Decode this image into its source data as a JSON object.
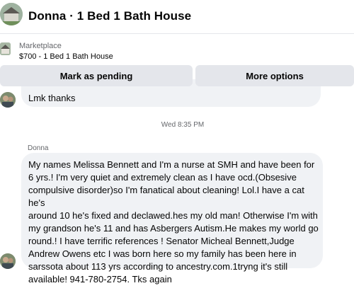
{
  "header": {
    "title": "Donna · 1 Bed 1 Bath House"
  },
  "listing": {
    "source": "Marketplace",
    "title": "$700 - 1 Bed 1 Bath House"
  },
  "actions": {
    "mark_pending": "Mark as pending",
    "more_options": "More options"
  },
  "conversation": {
    "previous_message": "Lmk thanks",
    "timestamp": "Wed 8:35 PM",
    "sender": "Donna",
    "message": "My names Melissa Bennett and I'm a nurse  at SMH  and have been for\n6 yrs.! I'm very quiet and extremely clean as I have ocd.(Obsesive\ncompulsive disorder)so I'm fanatical about cleaning! Lol.I have a cat he's\naround 10 he's fixed and declawed.hes my old man! Otherwise I'm with\nmy grandson he's 11 and has Asbergers Autism.He makes my world go\nround.! I have terrific references ! Senator Micheal Bennett,Judge\nAndrew Owens etc I was born here so my family  has been here in\nsarssota about 113 yrs according to  ancestry.com.1tryng it's still\navailable! 941-780-2754. Tks again"
  }
}
